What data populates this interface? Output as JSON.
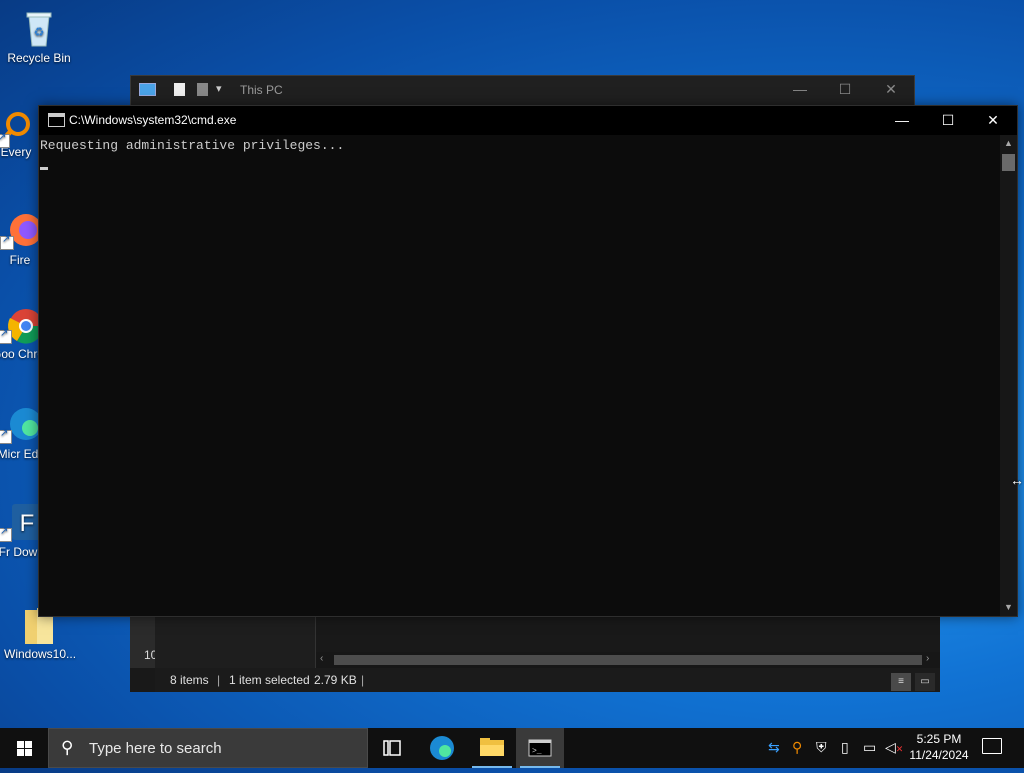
{
  "desktop": {
    "icons": [
      {
        "label": "Recycle Bin"
      },
      {
        "label": "Every"
      },
      {
        "label": "Fire"
      },
      {
        "label": "Goo Chro"
      },
      {
        "label": "Micr Ed"
      },
      {
        "label": "Fr Dow"
      },
      {
        "label": "Windows10..."
      }
    ]
  },
  "explorer": {
    "title": "This PC",
    "left_pane_number": "10",
    "status": {
      "items": "8 items",
      "selected": "1 item selected",
      "size": "2.79 KB"
    }
  },
  "cmd": {
    "title": "C:\\Windows\\system32\\cmd.exe",
    "output_line": "Requesting administrative privileges...",
    "controls": {
      "minimize": "—",
      "maximize": "☐",
      "close": "✕"
    }
  },
  "taskbar": {
    "search_placeholder": "Type here to search",
    "time": "5:25 PM",
    "date": "11/24/2024"
  },
  "colors": {
    "desktop_accent": "#1173d4",
    "cmd_background": "#0c0c0c",
    "taskbar_background": "#101010"
  }
}
